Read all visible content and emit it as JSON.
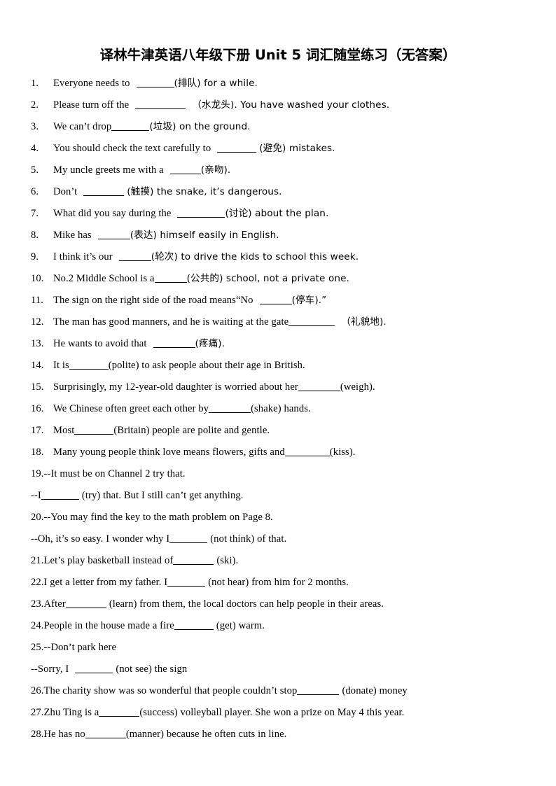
{
  "document": {
    "title": "译林牛津英语八年级下册 Unit 5 词汇随堂练习（无答案）",
    "title_parts": {
      "cn_lead": "译林牛津英语八年级下册",
      "unit": "Unit 5",
      "cn_tail": "词汇随堂练习（无答案）"
    }
  },
  "questions": [
    {
      "number": "1.",
      "style": "wide",
      "pre": "Everyone needs to",
      "blank_width": 54,
      "post": "(排队) for a while.",
      "gap_before_blank": "m",
      "gap_after_blank": "none"
    },
    {
      "number": "2.",
      "style": "wide",
      "pre": "Please turn off the",
      "blank_width": 72,
      "post": "（水龙头). You have washed your clothes.",
      "gap_before_blank": "m",
      "gap_after_blank": "m"
    },
    {
      "number": "3.",
      "style": "wide",
      "pre": "We can’t drop",
      "blank_width": 54,
      "post": "(垃圾) on the ground.",
      "gap_before_blank": "none",
      "gap_after_blank": "none"
    },
    {
      "number": "4.",
      "style": "wide",
      "pre": "You should check the text carefully to",
      "blank_width": 56,
      "post": "(避免) mistakes.",
      "gap_before_blank": "m",
      "gap_after_blank": "s"
    },
    {
      "number": "5.",
      "style": "wide",
      "pre": "My uncle greets me with a",
      "blank_width": 44,
      "post": "(亲吻).",
      "gap_before_blank": "m",
      "gap_after_blank": "none"
    },
    {
      "number": "6.",
      "style": "wide",
      "pre": "Don’t",
      "blank_width": 58,
      "post": "(触摸) the snake, it’s dangerous.",
      "gap_before_blank": "m",
      "gap_after_blank": "s"
    },
    {
      "number": "7.",
      "style": "wide",
      "pre": "What did you say during the",
      "blank_width": 68,
      "post": "(讨论) about the plan.",
      "gap_before_blank": "m",
      "gap_after_blank": "none"
    },
    {
      "number": "8.",
      "style": "wide",
      "pre": "Mike has",
      "blank_width": 46,
      "post": "(表达) himself easily in English.",
      "gap_before_blank": "m",
      "gap_after_blank": "none"
    },
    {
      "number": "9.",
      "style": "wide",
      "pre": "I think it’s our",
      "blank_width": 46,
      "post": "(轮次) to drive the kids to school this week.",
      "gap_before_blank": "m",
      "gap_after_blank": "none"
    },
    {
      "number": "10.",
      "style": "med",
      "pre": "No.2 Middle School is a",
      "blank_width": 46,
      "post": "(公共的) school, not a private one.",
      "gap_before_blank": "none",
      "gap_after_blank": "none"
    },
    {
      "number": "11.",
      "style": "med",
      "pre": "The sign on the right side of the road means“No",
      "blank_width": 46,
      "post": "(停车).”",
      "gap_before_blank": "m",
      "gap_after_blank": "none"
    },
    {
      "number": "12.",
      "style": "med",
      "pre": "The man has good manners, and he is waiting at the gate",
      "blank_width": 66,
      "post": "（礼貌地).",
      "gap_before_blank": "none",
      "gap_after_blank": "m"
    },
    {
      "number": "13.",
      "style": "med",
      "pre": "He wants to avoid that",
      "blank_width": 60,
      "post": "(疼痛).",
      "gap_before_blank": "m",
      "gap_after_blank": "none"
    },
    {
      "number": "14.",
      "style": "med",
      "pre": "It is",
      "blank_width": 56,
      "post": "(polite) to ask people about their age in British.",
      "gap_before_blank": "none",
      "gap_after_blank": "none"
    },
    {
      "number": "15.",
      "style": "med",
      "pre": "Surprisingly, my 12-year-old daughter is worried about her",
      "blank_width": 60,
      "post": "(weigh).",
      "gap_before_blank": "none",
      "gap_after_blank": "none"
    },
    {
      "number": "16.",
      "style": "med",
      "pre": "We Chinese often greet each other by",
      "blank_width": 60,
      "post": "(shake) hands.",
      "gap_before_blank": "none",
      "gap_after_blank": "none"
    },
    {
      "number": "17.",
      "style": "med",
      "pre": "Most",
      "blank_width": 56,
      "post": "(Britain) people are polite and gentle.",
      "gap_before_blank": "none",
      "gap_after_blank": "none"
    },
    {
      "number": "18.",
      "style": "med",
      "pre": "Many young people think love means flowers, gifts and",
      "blank_width": 64,
      "post": "(kiss).",
      "gap_before_blank": "none",
      "gap_after_blank": "none"
    },
    {
      "number": "19.",
      "style": "tight",
      "pre": "--It must be on Channel 2 try that.",
      "blank_width": 0,
      "post": "",
      "gap_before_blank": "none",
      "gap_after_blank": "none"
    },
    {
      "number": "",
      "style": "tight",
      "pre": "--I",
      "blank_width": 54,
      "post": "(try) that. But I still can’t get anything.",
      "gap_before_blank": "none",
      "gap_after_blank": "s"
    },
    {
      "number": "20.",
      "style": "tight",
      "pre": "--You may find the key to the math problem on Page 8.",
      "blank_width": 0,
      "post": "",
      "gap_before_blank": "none",
      "gap_after_blank": "none"
    },
    {
      "number": "",
      "style": "tight",
      "pre": "--Oh, it’s so easy. I wonder why I",
      "blank_width": 54,
      "post": "(not think) of that.",
      "gap_before_blank": "none",
      "gap_after_blank": "s"
    },
    {
      "number": "21.",
      "style": "tight",
      "pre": "Let’s play basketball instead of",
      "blank_width": 58,
      "post": "(ski).",
      "gap_before_blank": "none",
      "gap_after_blank": "s"
    },
    {
      "number": "22.",
      "style": "tight",
      "pre": "I get a letter from my father. I",
      "blank_width": 54,
      "post": "(not hear) from him for 2 months.",
      "gap_before_blank": "none",
      "gap_after_blank": "s"
    },
    {
      "number": "23.",
      "style": "tight",
      "pre": "After",
      "blank_width": 58,
      "post": "(learn) from them, the local doctors can help people in their areas.",
      "gap_before_blank": "none",
      "gap_after_blank": "s"
    },
    {
      "number": "24.",
      "style": "tight",
      "pre": "People in the house made a fire",
      "blank_width": 56,
      "post": "(get) warm.",
      "gap_before_blank": "none",
      "gap_after_blank": "s"
    },
    {
      "number": "25.",
      "style": "tight",
      "pre": "--Don’t park here",
      "blank_width": 0,
      "post": "",
      "gap_before_blank": "none",
      "gap_after_blank": "none"
    },
    {
      "number": "",
      "style": "tight",
      "pre": "--Sorry, I",
      "blank_width": 54,
      "post": "(not see) the sign",
      "gap_before_blank": "m",
      "gap_after_blank": "s"
    },
    {
      "number": "26.",
      "style": "tight",
      "pre": "The charity show was so wonderful that people couldn’t stop",
      "blank_width": 60,
      "post": "(donate) money",
      "gap_before_blank": "none",
      "gap_after_blank": "s"
    },
    {
      "number": "27.",
      "style": "tight",
      "pre": "Zhu Ting is a",
      "blank_width": 58,
      "post": "(success) volleyball player. She won a prize on May 4 this year.",
      "gap_before_blank": "none",
      "gap_after_blank": "none"
    },
    {
      "number": "28.",
      "style": "tight",
      "pre": "He has no",
      "blank_width": 58,
      "post": "(manner) because he often cuts in line.",
      "gap_before_blank": "none",
      "gap_after_blank": "none"
    }
  ]
}
